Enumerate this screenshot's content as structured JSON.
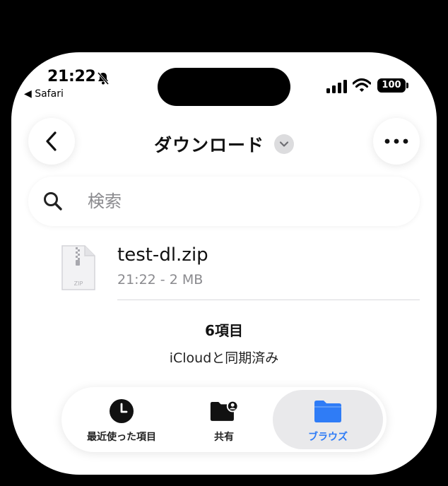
{
  "status_bar": {
    "time": "21:22",
    "back_app": "◀ Safari",
    "battery": "100"
  },
  "navbar": {
    "title": "ダウンロード"
  },
  "search": {
    "placeholder": "検索"
  },
  "files": [
    {
      "name": "test-dl.zip",
      "meta": "21:22 - 2 MB",
      "icon_label": "ZIP"
    }
  ],
  "footer": {
    "item_count": "6項目",
    "sync_status": "iCloudと同期済み"
  },
  "tabs": [
    {
      "label": "最近使った項目",
      "icon": "clock-icon"
    },
    {
      "label": "共有",
      "icon": "shared-folder-icon"
    },
    {
      "label": "ブラウズ",
      "icon": "folder-icon",
      "selected": true
    }
  ],
  "colors": {
    "accent": "#2f7cf6",
    "secondary_text": "#8a8a8e"
  }
}
